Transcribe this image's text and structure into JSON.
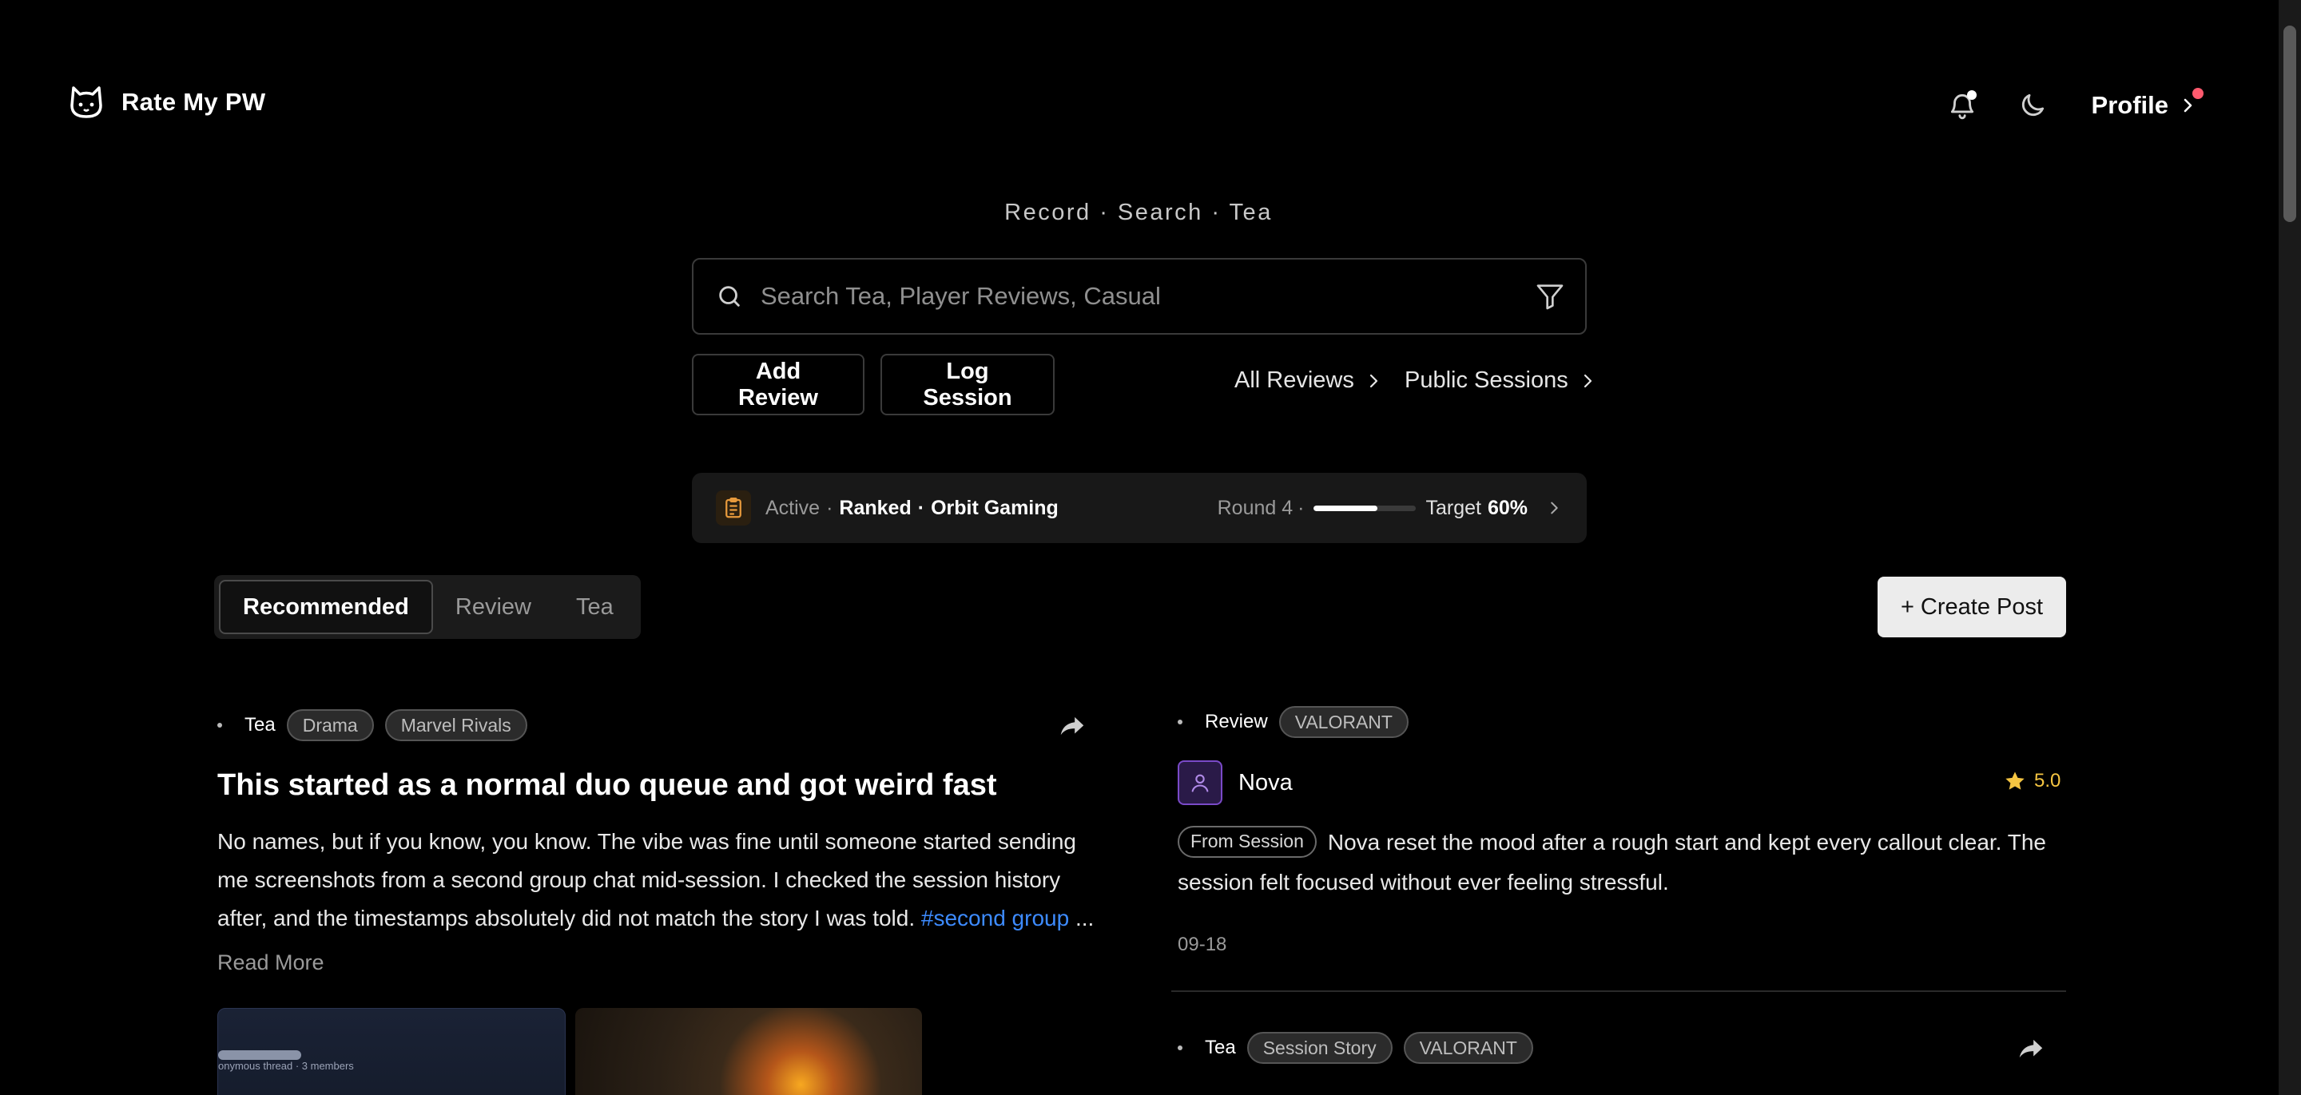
{
  "app": {
    "name": "Rate My PW"
  },
  "header": {
    "profile_label": "Profile"
  },
  "tagline": "Record · Search · Tea",
  "search": {
    "placeholder": "Search Tea, Player Reviews, Casual",
    "value": ""
  },
  "actions": {
    "add_review": "Add Review",
    "log_session": "Log Session",
    "all_reviews": "All Reviews",
    "public_sessions": "Public Sessions"
  },
  "active_session": {
    "status": "Active",
    "mode": "Ranked",
    "org": "Orbit Gaming",
    "round": "Round 4",
    "progress": 0.62,
    "target_label": "Target",
    "target_value": "60%"
  },
  "feed_tabs": [
    {
      "label": "Recommended",
      "active": true
    },
    {
      "label": "Review",
      "active": false
    },
    {
      "label": "Tea",
      "active": false
    }
  ],
  "create_post": "+ Create Post",
  "posts": {
    "tea": {
      "type": "Tea",
      "tags": [
        "Drama",
        "Marvel Rivals"
      ],
      "title": "This started as a normal duo queue and got weird fast",
      "body_line1": "No names, but if you know, you know. The vibe was fine until someone started sending",
      "body_line2": "me screenshots from a second group chat mid-session. I checked the session history",
      "body_line3": "after, and the timestamps absolutely did not match the story I was told.",
      "hashtag": "#second group",
      "ellipsis": " ...",
      "read_more": "Read More",
      "thumb_text": "onymous thread · 3 members"
    },
    "review": {
      "type": "Review",
      "tags": [
        "VALORANT"
      ],
      "user": "Nova",
      "rating": "5.0",
      "source_badge": "From Session",
      "body": "Nova reset the mood after a rough start and kept every callout clear. The session felt focused without ever feeling stressful.",
      "date": "09-18"
    },
    "tea2": {
      "type": "Tea",
      "tags": [
        "Session Story",
        "VALORANT"
      ]
    }
  },
  "colors": {
    "accent_link": "#3d8bff",
    "notification_dot_white": "#ffffff",
    "profile_dot": "#ff5a6e",
    "star": "#f5c542",
    "session_icon": "#e89a3c",
    "avatar_border": "#7a4ac8"
  }
}
